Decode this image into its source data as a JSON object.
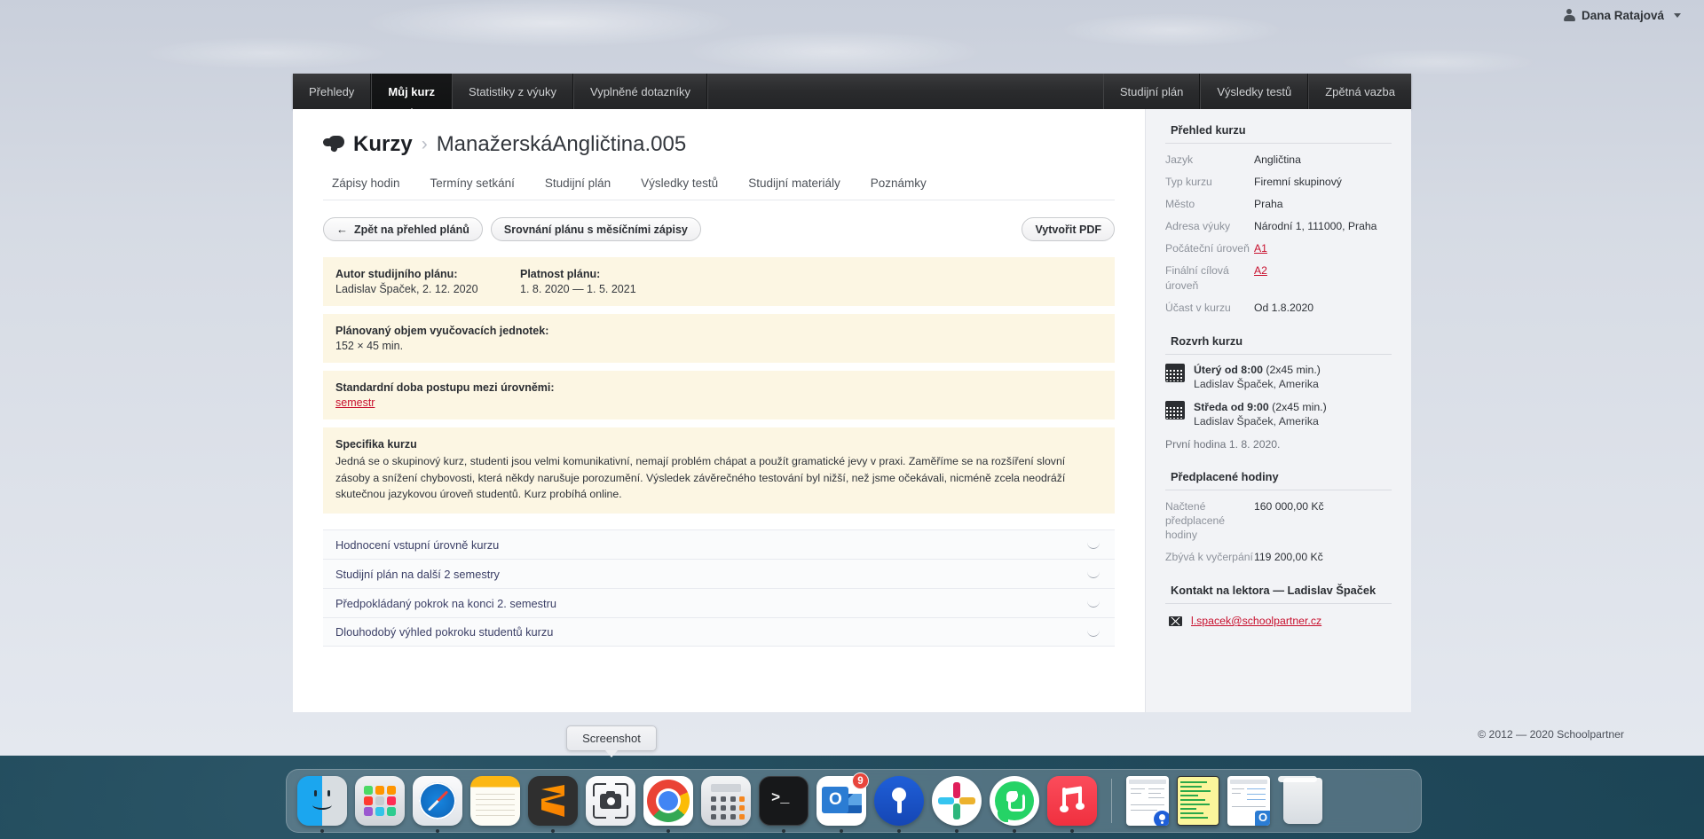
{
  "topbar": {
    "user_name": "Dana Ratajová",
    "user_icon": "user-icon",
    "caret_icon": "chevron-down-icon"
  },
  "navbar": {
    "left_items": [
      {
        "label": "Přehledy",
        "active": false
      },
      {
        "label": "Můj kurz",
        "active": true
      },
      {
        "label": "Statistiky z výuky",
        "active": false
      },
      {
        "label": "Vyplněné dotazníky",
        "active": false
      }
    ],
    "right_items": [
      {
        "label": "Studijní plán"
      },
      {
        "label": "Výsledky testů"
      },
      {
        "label": "Zpětná vazba"
      }
    ]
  },
  "breadcrumb": {
    "icon": "speech-bubbles-icon",
    "root": "Kurzy",
    "separator": "›",
    "current": "ManažerskáAngličtina.005"
  },
  "subtabs": [
    "Zápisy hodin",
    "Termíny setkání",
    "Studijní plán",
    "Výsledky testů",
    "Studijní materiály",
    "Poznámky"
  ],
  "buttons": {
    "back_arrow": "←",
    "back": "Zpět na přehled plánů",
    "compare": "Srovnání plánu s měsíčními zápisy",
    "create_pdf": "Vytvořit PDF"
  },
  "plan_info": {
    "author_label": "Autor studijního plánu:",
    "author_value": "Ladislav Špaček, 2. 12. 2020",
    "validity_label": "Platnost plánu:",
    "validity_value": "1. 8. 2020 — 1. 5. 2021",
    "volume_label": "Plánovaný objem vyučovacích jednotek:",
    "volume_value": "152 × 45 min.",
    "progress_label": "Standardní doba postupu mezi úrovněmi:",
    "progress_value": "semestr",
    "specifics_title": "Specifika kurzu",
    "specifics_text": "Jedná se o skupinový kurz, studenti jsou velmi komunikativní, nemají problém chápat a použít gramatické jevy v praxi. Zaměříme se na rozšíření slovní zásoby a snížení chybovosti, která někdy narušuje porozumění. Výsledek závěrečného testování byl nižší, než jsme očekávali, nicméně zcela neodráží skutečnou jazykovou úroveň studentů. Kurz probíhá online."
  },
  "accordion": [
    {
      "title": "Hodnocení vstupní úrovně kurzu",
      "icon": "chevron-collapse-icon"
    },
    {
      "title": "Studijní plán na další 2 semestry",
      "icon": "chevron-collapse-icon"
    },
    {
      "title": "Předpokládaný pokrok na konci 2. semestru",
      "icon": "chevron-collapse-icon"
    },
    {
      "title": "Dlouhodobý výhled pokroku studentů kurzu",
      "icon": "chevron-collapse-icon"
    }
  ],
  "aside": {
    "overview_title": "Přehled kurzu",
    "overview_rows": [
      {
        "key": "Jazyk",
        "value": "Angličtina",
        "link": false
      },
      {
        "key": "Typ kurzu",
        "value": "Firemní skupinový",
        "link": false
      },
      {
        "key": "Město",
        "value": "Praha",
        "link": false
      },
      {
        "key": "Adresa výuky",
        "value": "Národní 1, 111000, Praha",
        "link": false
      },
      {
        "key": "Počáteční úroveň",
        "value": "A1",
        "link": true
      },
      {
        "key": "Finální cílová úroveň",
        "value": "A2",
        "link": true
      },
      {
        "key": "Účast v kurzu",
        "value": "Od 1.8.2020",
        "link": false
      }
    ],
    "schedule_title": "Rozvrh kurzu",
    "schedule": [
      {
        "icon": "calendar-icon",
        "day": "Úterý od 8:00",
        "duration": "(2x45 min.)",
        "teacher": "Ladislav Špaček, Amerika"
      },
      {
        "icon": "calendar-icon",
        "day": "Středa od 9:00",
        "duration": "(2x45 min.)",
        "teacher": "Ladislav Špaček, Amerika"
      }
    ],
    "first_lesson": "První hodina 1. 8. 2020.",
    "prepaid_title": "Předplacené hodiny",
    "prepaid_rows": [
      {
        "key": "Načtené předplacené hodiny",
        "value": "160 000,00 Kč"
      },
      {
        "key": "Zbývá k vyčerpání",
        "value": "119 200,00 Kč"
      }
    ],
    "contact_title": "Kontakt na lektora — Ladislav Špaček",
    "contact_icon": "envelope-icon",
    "contact_email": "l.spacek@schoolpartner.cz"
  },
  "footer": {
    "copyright": "© 2012 — 2020 Schoolpartner"
  },
  "tooltip": {
    "label": "Screenshot"
  },
  "dock": {
    "items": [
      {
        "name": "finder",
        "label": "Finder",
        "running": true
      },
      {
        "name": "launchpad",
        "label": "Launchpad",
        "running": false
      },
      {
        "name": "safari",
        "label": "Safari",
        "running": true
      },
      {
        "name": "notes",
        "label": "Notes",
        "running": false
      },
      {
        "name": "sublime-text",
        "label": "Sublime Text",
        "running": true
      },
      {
        "name": "screenshot",
        "label": "Screenshot",
        "running": false
      },
      {
        "name": "google-chrome",
        "label": "Google Chrome",
        "running": true
      },
      {
        "name": "calculator",
        "label": "Calculator",
        "running": false
      },
      {
        "name": "terminal",
        "label": "Terminal",
        "running": true
      },
      {
        "name": "outlook",
        "label": "Outlook",
        "running": true,
        "badge": "9"
      },
      {
        "name": "1password",
        "label": "1Password",
        "running": true
      },
      {
        "name": "slack",
        "label": "Slack",
        "running": true
      },
      {
        "name": "whatsapp",
        "label": "WhatsApp",
        "running": true
      },
      {
        "name": "music",
        "label": "Music",
        "running": true
      }
    ],
    "minimized": [
      {
        "name": "minimized-window-1password",
        "label": "1Password window"
      },
      {
        "name": "minimized-window-notes",
        "label": "Notes window"
      },
      {
        "name": "minimized-window-outlook",
        "label": "Outlook window"
      }
    ],
    "trash": {
      "name": "trash",
      "label": "Trash"
    }
  },
  "colors": {
    "accent_red": "#c8102e",
    "beige": "#fcf6e3",
    "nav_dark": "#2a2b2d",
    "badge_red": "#e8453c"
  }
}
